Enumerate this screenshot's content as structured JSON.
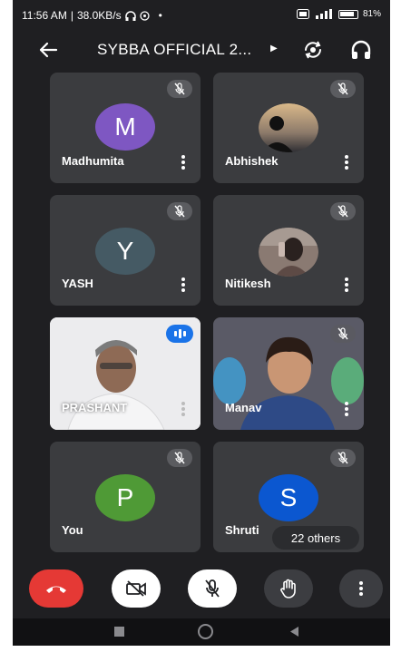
{
  "status_bar": {
    "time": "11:56 AM",
    "speed": "38.0KB/s",
    "dot": "•",
    "battery": "81%"
  },
  "header": {
    "title": "SYBBA OFFICIAL 2..."
  },
  "participants": [
    {
      "name": "Madhumita",
      "initial": "M",
      "avatar_color": "#7e57c2",
      "muted": true
    },
    {
      "name": "Abhishek",
      "initial": "",
      "avatar_color": "#5a5a5a",
      "muted": true
    },
    {
      "name": "YASH",
      "initial": "Y",
      "avatar_color": "#455a64",
      "muted": true
    },
    {
      "name": "Nitikesh",
      "initial": "",
      "avatar_color": "#6b5a55",
      "muted": true
    },
    {
      "name": "PRASHANT",
      "initial": "",
      "avatar_color": "",
      "muted": false,
      "speaking": true
    },
    {
      "name": "Manav",
      "initial": "",
      "avatar_color": "",
      "muted": true
    },
    {
      "name": "You",
      "initial": "P",
      "avatar_color": "#4f9a36",
      "muted": true
    },
    {
      "name": "Shruti",
      "initial": "S",
      "avatar_color": "#0b57d0",
      "muted": true
    }
  ],
  "others_label": "22 others",
  "controls": {
    "end_call_color": "#e53935"
  },
  "colors": {
    "background": "#1f1f22",
    "tile": "#3b3c3f",
    "accent_blue": "#1a73e8"
  }
}
